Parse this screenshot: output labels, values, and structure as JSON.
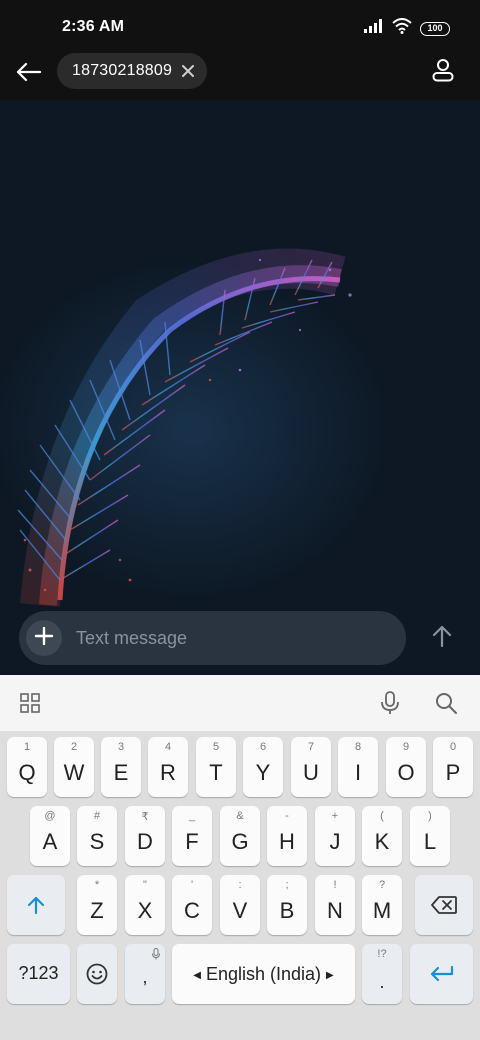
{
  "status_bar": {
    "time": "2:36 AM",
    "battery": "100",
    "icons": [
      "signal-icon",
      "wifi-icon",
      "battery-icon"
    ]
  },
  "header": {
    "recipient": "18730218809",
    "icons": [
      "back-arrow-icon",
      "close-icon",
      "contact-icon"
    ]
  },
  "compose": {
    "placeholder": "Text message",
    "icons": [
      "plus-icon",
      "send-arrow-icon"
    ]
  },
  "keyboard_toolbar": {
    "icons": [
      "apps-grid-icon",
      "microphone-icon",
      "search-icon"
    ]
  },
  "keyboard": {
    "row1": [
      {
        "main": "Q",
        "hint": "1"
      },
      {
        "main": "W",
        "hint": "2"
      },
      {
        "main": "E",
        "hint": "3"
      },
      {
        "main": "R",
        "hint": "4"
      },
      {
        "main": "T",
        "hint": "5"
      },
      {
        "main": "Y",
        "hint": "6"
      },
      {
        "main": "U",
        "hint": "7"
      },
      {
        "main": "I",
        "hint": "8"
      },
      {
        "main": "O",
        "hint": "9"
      },
      {
        "main": "P",
        "hint": "0"
      }
    ],
    "row2": [
      {
        "main": "A",
        "hint": "@"
      },
      {
        "main": "S",
        "hint": "#"
      },
      {
        "main": "D",
        "hint": "₹"
      },
      {
        "main": "F",
        "hint": "_"
      },
      {
        "main": "G",
        "hint": "&"
      },
      {
        "main": "H",
        "hint": "-"
      },
      {
        "main": "J",
        "hint": "+"
      },
      {
        "main": "K",
        "hint": "("
      },
      {
        "main": "L",
        "hint": ")"
      }
    ],
    "row3": [
      {
        "main": "Z",
        "hint": "*"
      },
      {
        "main": "X",
        "hint": "\""
      },
      {
        "main": "C",
        "hint": "'"
      },
      {
        "main": "V",
        "hint": ":"
      },
      {
        "main": "B",
        "hint": ";"
      },
      {
        "main": "N",
        "hint": "!"
      },
      {
        "main": "M",
        "hint": "?"
      }
    ],
    "symbols_key": "?123",
    "comma_key": ",",
    "space_label": "English (India)",
    "period_key": ".",
    "period_hint": "!?",
    "icons": [
      "shift-icon",
      "backspace-icon",
      "emoji-icon",
      "enter-icon"
    ]
  },
  "colors": {
    "accent": "#1a8fd6",
    "background": "#0d1824"
  }
}
